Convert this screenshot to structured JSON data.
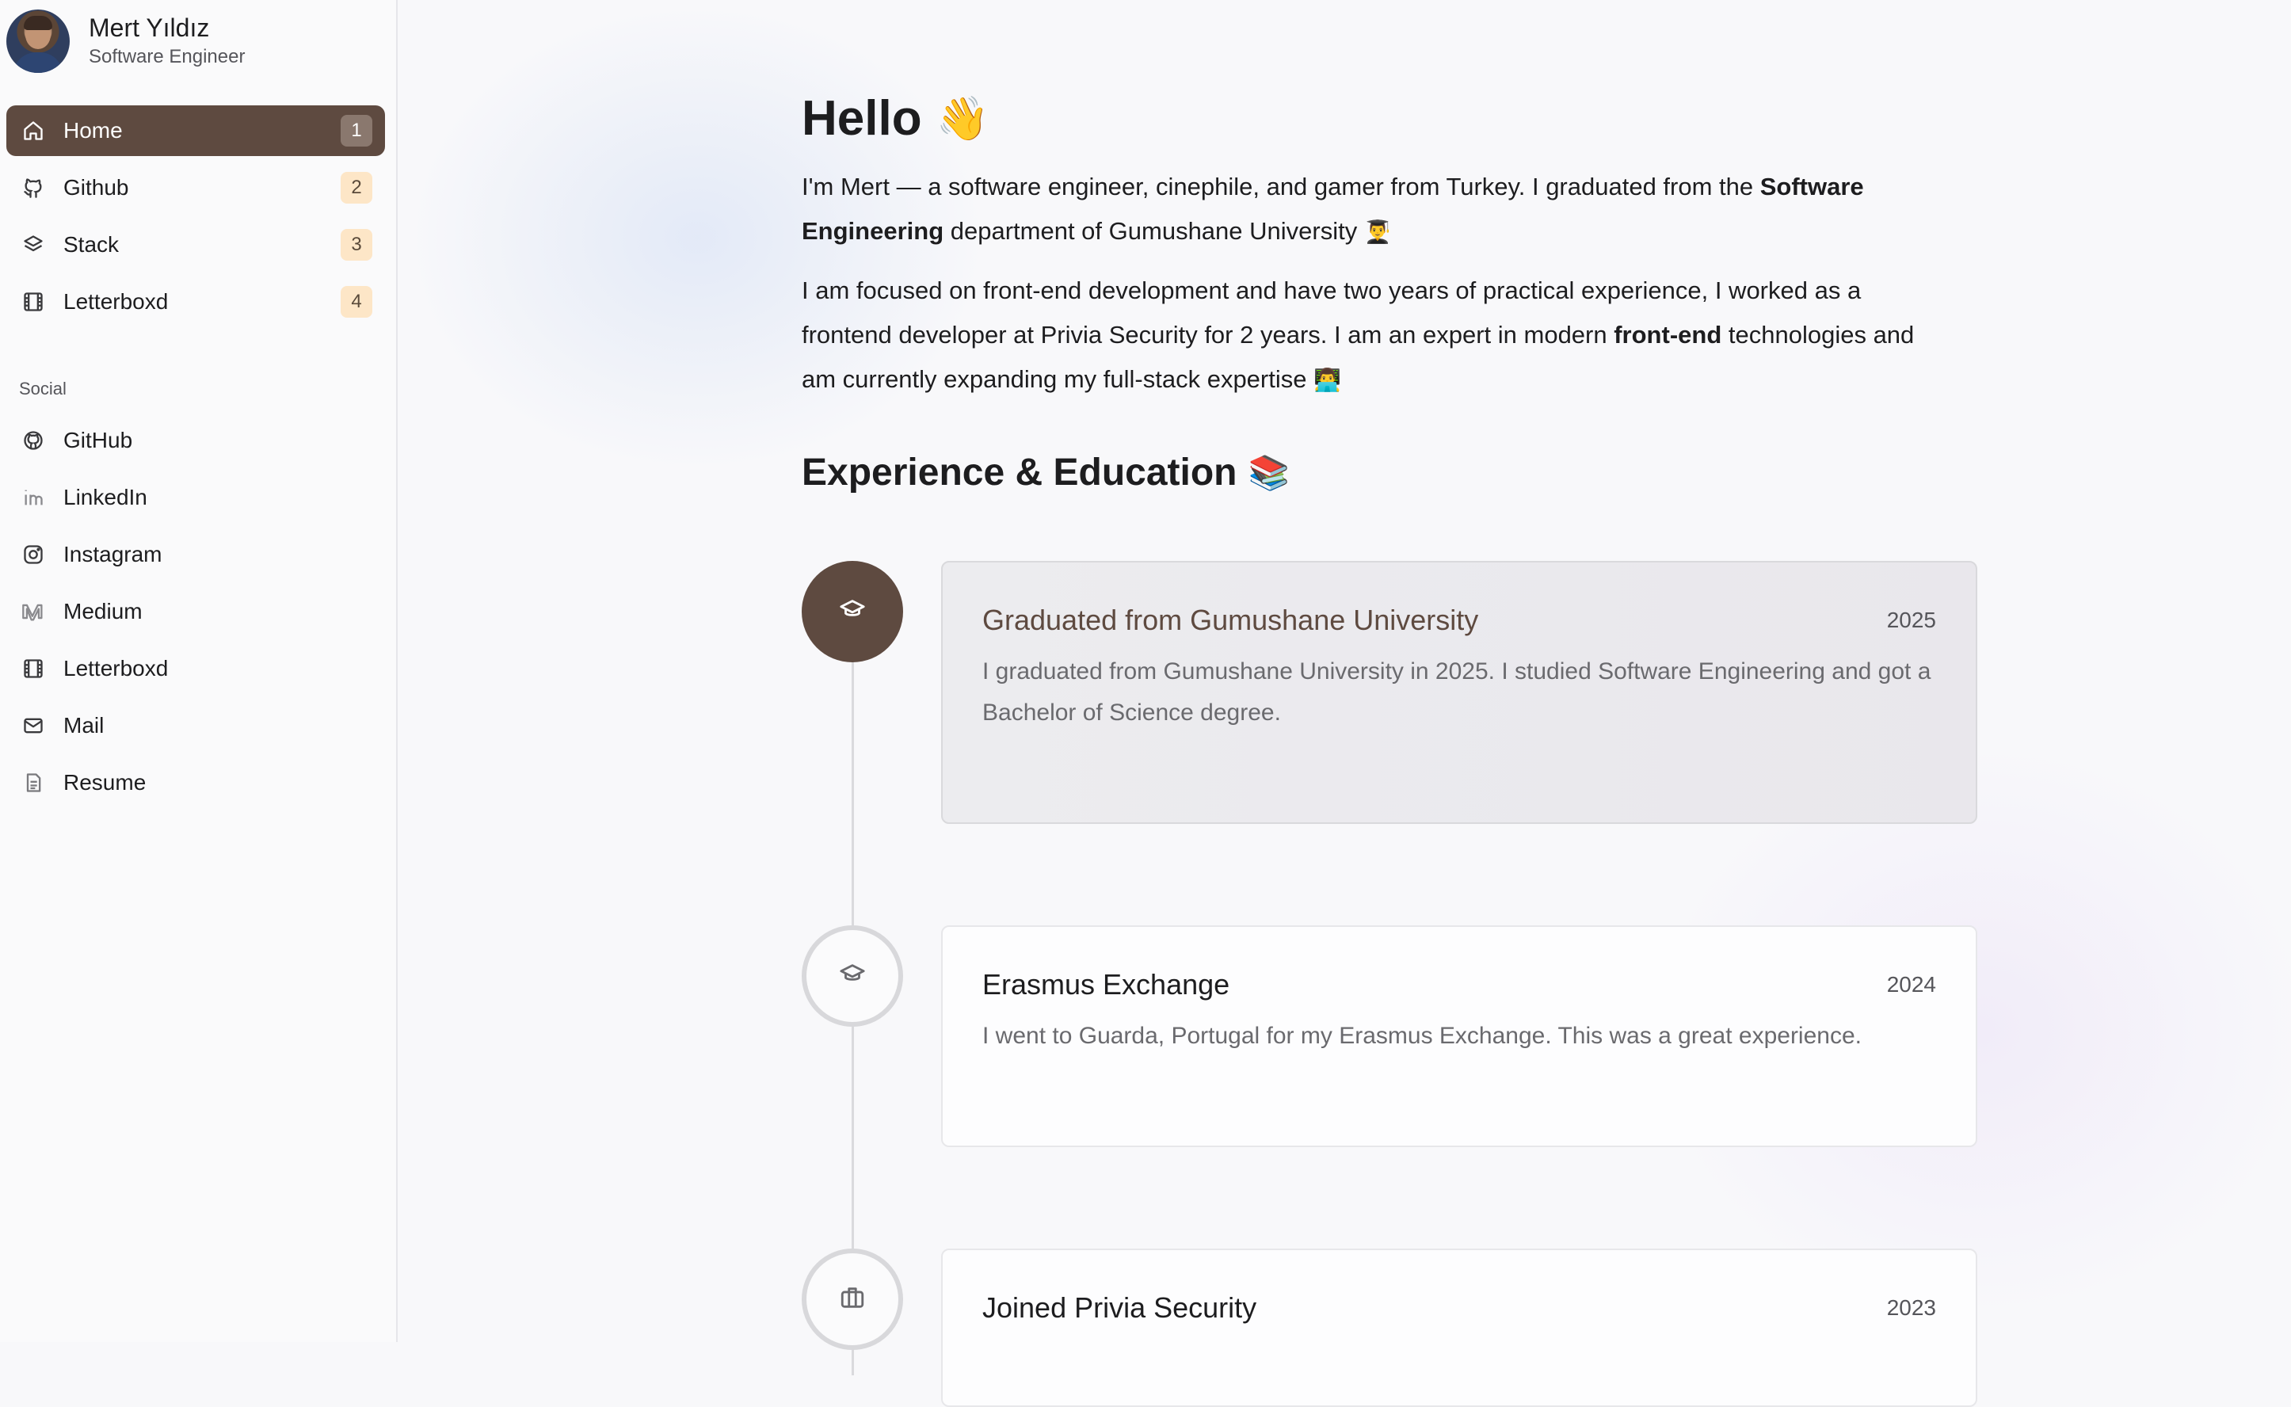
{
  "profile": {
    "name": "Mert Yıldız",
    "role": "Software Engineer"
  },
  "nav": [
    {
      "label": "Home",
      "badge": "1",
      "icon": "home-icon",
      "active": true
    },
    {
      "label": "Github",
      "badge": "2",
      "icon": "github-branch-icon"
    },
    {
      "label": "Stack",
      "badge": "3",
      "icon": "layers-icon"
    },
    {
      "label": "Letterboxd",
      "badge": "4",
      "icon": "film-icon"
    }
  ],
  "social": {
    "heading": "Social",
    "items": [
      {
        "label": "GitHub",
        "icon": "github-icon"
      },
      {
        "label": "LinkedIn",
        "icon": "linkedin-icon"
      },
      {
        "label": "Instagram",
        "icon": "instagram-icon"
      },
      {
        "label": "Medium",
        "icon": "medium-icon"
      },
      {
        "label": "Letterboxd",
        "icon": "film-icon"
      },
      {
        "label": "Mail",
        "icon": "mail-icon"
      },
      {
        "label": "Resume",
        "icon": "document-icon"
      }
    ]
  },
  "main": {
    "hello": "Hello",
    "hello_emoji": "👋",
    "intro": {
      "p1_a": "I'm Mert — a software engineer, cinephile, and gamer from Turkey. I graduated from the ",
      "p1_bold": "Software Engineering",
      "p1_b": " department of Gumushane University ",
      "p1_emoji": "👨‍🎓",
      "p2_a": "I am focused on front-end development and have two years of practical experience, I worked as a frontend developer at Privia Security for 2 years. I am an expert in modern ",
      "p2_bold": "front-end",
      "p2_b": " technologies and am currently expanding my full-stack expertise ",
      "p2_emoji": "👨‍💻"
    },
    "section_title": "Experience & Education",
    "section_emoji": "📚",
    "timeline": [
      {
        "title": "Graduated from Gumushane University",
        "year": "2025",
        "desc": "I graduated from Gumushane University in 2025. I studied Software Engineering and got a Bachelor of Science degree.",
        "icon": "graduation-cap-icon"
      },
      {
        "title": "Erasmus Exchange",
        "year": "2024",
        "desc": "I went to Guarda, Portugal for my Erasmus Exchange. This was a great experience.",
        "icon": "graduation-cap-icon"
      },
      {
        "title": "Joined Privia Security",
        "year": "2023",
        "icon": "briefcase-icon"
      }
    ]
  }
}
